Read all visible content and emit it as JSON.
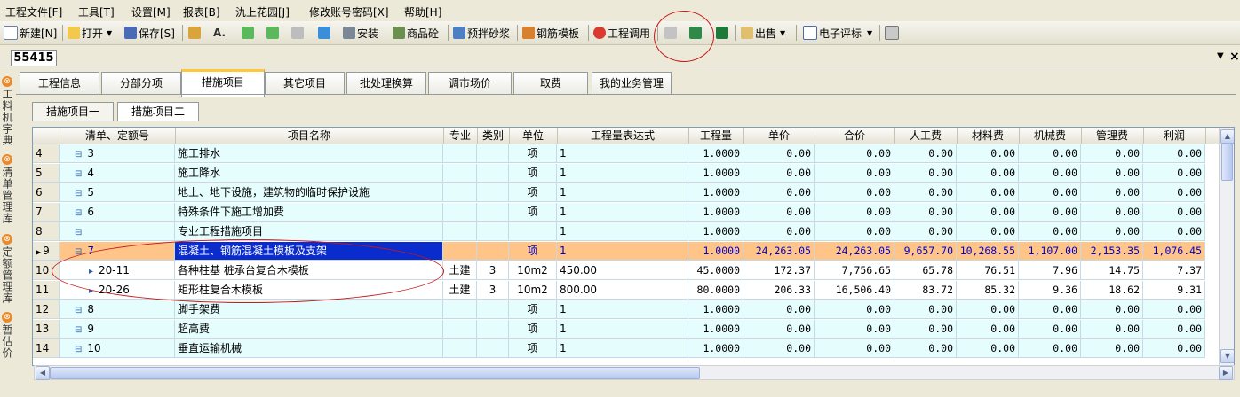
{
  "menu": [
    "工程文件[F]",
    "工具[T]",
    "设置[M]",
    "报表[B]",
    "氿上花园[J]",
    "修改账号密码[X]",
    "帮助[H]"
  ],
  "toolbar": {
    "new": "新建[N]",
    "open": "打开",
    "save": "保存[S]",
    "install": "安装",
    "concrete": "商品砼",
    "mortar": "预拌砂浆",
    "rebar_form": "钢筋模板",
    "project_call": "工程调用",
    "sell": "出售",
    "e_review": "电子评标"
  },
  "doc_tab": "55415",
  "sidebar": [
    {
      "label": "工料机字典"
    },
    {
      "label": "清单管理库"
    },
    {
      "label": "定额管理库"
    },
    {
      "label": "暂估价"
    }
  ],
  "main_tabs": [
    "工程信息",
    "分部分项",
    "措施项目",
    "其它项目",
    "批处理换算",
    "调市场价",
    "取费",
    "我的业务管理"
  ],
  "active_main_tab": "措施项目",
  "sub_tabs": [
    "措施项目一",
    "措施项目二"
  ],
  "active_sub_tab": "措施项目二",
  "columns": [
    "清单、定额号",
    "项目名称",
    "专业",
    "类别",
    "单位",
    "工程量表达式",
    "工程量",
    "单价",
    "合价",
    "人工费",
    "材料费",
    "机械费",
    "管理费",
    "利润"
  ],
  "rows": [
    {
      "idx": "4",
      "code": "3",
      "name": "施工排水",
      "major": "",
      "cat": "",
      "unit": "项",
      "expr": "1",
      "qty": "1.0000",
      "price": "0.00",
      "total": "0.00",
      "labor": "0.00",
      "material": "0.00",
      "machine": "0.00",
      "mgmt": "0.00",
      "profit": "0.00",
      "type": "parent"
    },
    {
      "idx": "5",
      "code": "4",
      "name": "施工降水",
      "major": "",
      "cat": "",
      "unit": "项",
      "expr": "1",
      "qty": "1.0000",
      "price": "0.00",
      "total": "0.00",
      "labor": "0.00",
      "material": "0.00",
      "machine": "0.00",
      "mgmt": "0.00",
      "profit": "0.00",
      "type": "parent"
    },
    {
      "idx": "6",
      "code": "5",
      "name": "地上、地下设施，建筑物的临时保护设施",
      "major": "",
      "cat": "",
      "unit": "项",
      "expr": "1",
      "qty": "1.0000",
      "price": "0.00",
      "total": "0.00",
      "labor": "0.00",
      "material": "0.00",
      "machine": "0.00",
      "mgmt": "0.00",
      "profit": "0.00",
      "type": "parent"
    },
    {
      "idx": "7",
      "code": "6",
      "name": "特殊条件下施工增加费",
      "major": "",
      "cat": "",
      "unit": "项",
      "expr": "1",
      "qty": "1.0000",
      "price": "0.00",
      "total": "0.00",
      "labor": "0.00",
      "material": "0.00",
      "machine": "0.00",
      "mgmt": "0.00",
      "profit": "0.00",
      "type": "parent"
    },
    {
      "idx": "8",
      "code": "",
      "name": "专业工程措施项目",
      "major": "",
      "cat": "",
      "unit": "",
      "expr": "1",
      "qty": "1.0000",
      "price": "0.00",
      "total": "0.00",
      "labor": "0.00",
      "material": "0.00",
      "machine": "0.00",
      "mgmt": "0.00",
      "profit": "0.00",
      "type": "parent"
    },
    {
      "idx": "9",
      "code": "7",
      "name": "混凝土、钢筋混凝土模板及支架",
      "major": "",
      "cat": "",
      "unit": "项",
      "expr": "1",
      "qty": "1.0000",
      "price": "24,263.05",
      "total": "24,263.05",
      "labor": "9,657.70",
      "material": "10,268.55",
      "machine": "1,107.00",
      "mgmt": "2,153.35",
      "profit": "1,076.45",
      "type": "selected"
    },
    {
      "idx": "10",
      "code": "20-11",
      "name": "各种柱基 桩承台复合木模板",
      "major": "土建",
      "cat": "3",
      "unit": "10m2",
      "expr": "450.00",
      "qty": "45.0000",
      "price": "172.37",
      "total": "7,756.65",
      "labor": "65.78",
      "material": "76.51",
      "machine": "7.96",
      "mgmt": "14.75",
      "profit": "7.37",
      "type": "child"
    },
    {
      "idx": "11",
      "code": "20-26",
      "name": "矩形柱复合木模板",
      "major": "土建",
      "cat": "3",
      "unit": "10m2",
      "expr": "800.00",
      "qty": "80.0000",
      "price": "206.33",
      "total": "16,506.40",
      "labor": "83.72",
      "material": "85.32",
      "machine": "9.36",
      "mgmt": "18.62",
      "profit": "9.31",
      "type": "child"
    },
    {
      "idx": "12",
      "code": "8",
      "name": "脚手架费",
      "major": "",
      "cat": "",
      "unit": "项",
      "expr": "1",
      "qty": "1.0000",
      "price": "0.00",
      "total": "0.00",
      "labor": "0.00",
      "material": "0.00",
      "machine": "0.00",
      "mgmt": "0.00",
      "profit": "0.00",
      "type": "parent"
    },
    {
      "idx": "13",
      "code": "9",
      "name": "超高费",
      "major": "",
      "cat": "",
      "unit": "项",
      "expr": "1",
      "qty": "1.0000",
      "price": "0.00",
      "total": "0.00",
      "labor": "0.00",
      "material": "0.00",
      "machine": "0.00",
      "mgmt": "0.00",
      "profit": "0.00",
      "type": "parent"
    },
    {
      "idx": "14",
      "code": "10",
      "name": "垂直运输机械",
      "major": "",
      "cat": "",
      "unit": "项",
      "expr": "1",
      "qty": "1.0000",
      "price": "0.00",
      "total": "0.00",
      "labor": "0.00",
      "material": "0.00",
      "machine": "0.00",
      "mgmt": "0.00",
      "profit": "0.00",
      "type": "parent"
    }
  ],
  "colors": {
    "selected_row": "#ffc488",
    "selected_name": "#0a2ccc",
    "parent_row": "#e5fdfd",
    "annotation": "#c81818",
    "active_tab_accent": "#ffc83c"
  }
}
